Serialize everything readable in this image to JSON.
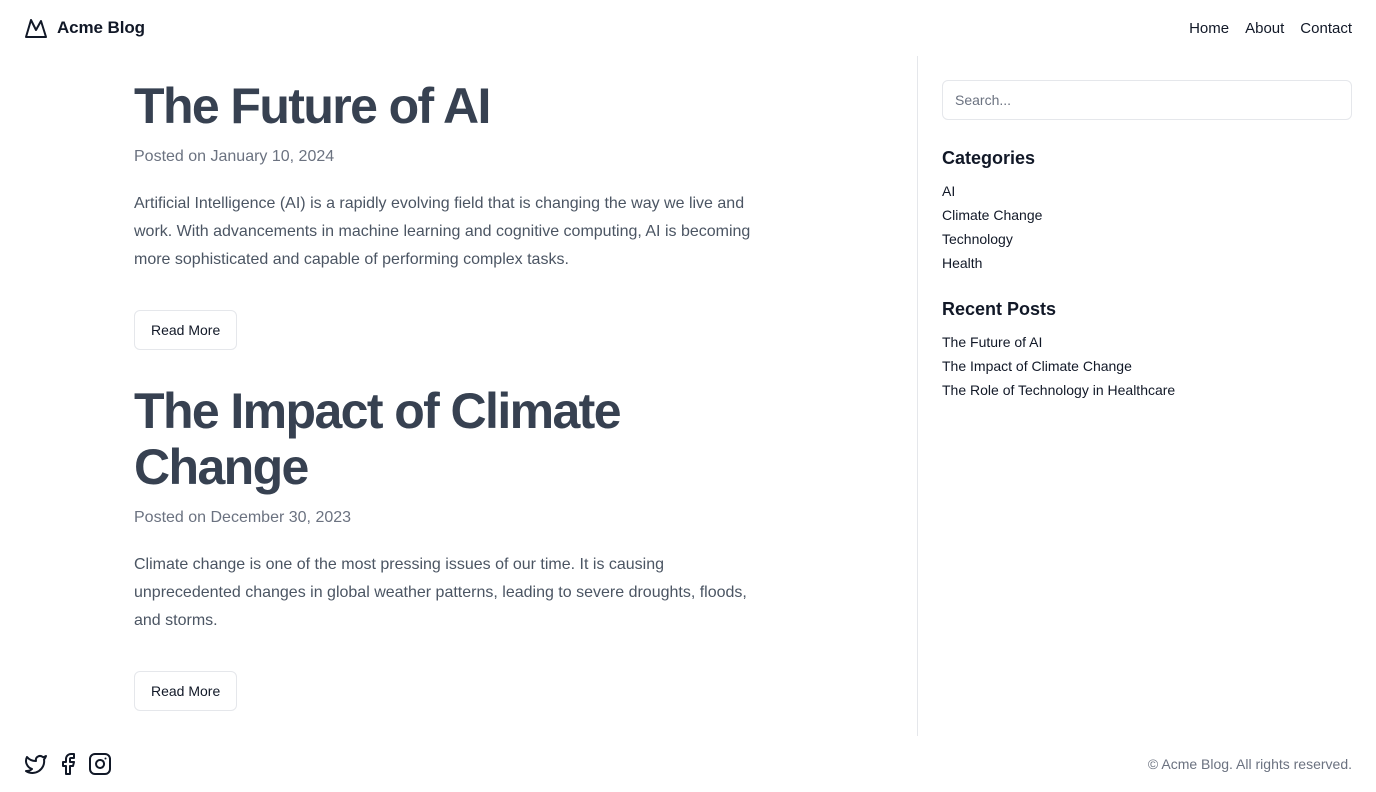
{
  "brand": {
    "name": "Acme Blog",
    "icon": "mountain-icon"
  },
  "nav": [
    {
      "label": "Home"
    },
    {
      "label": "About"
    },
    {
      "label": "Contact"
    }
  ],
  "posts": [
    {
      "title": "The Future of AI",
      "date": "Posted on January 10, 2024",
      "excerpt": "Artificial Intelligence (AI) is a rapidly evolving field that is changing the way we live and work. With advancements in machine learning and cognitive computing, AI is becoming more sophisticated and capable of performing complex tasks.",
      "button": "Read More"
    },
    {
      "title": "The Impact of Climate Change",
      "date": "Posted on December 30, 2023",
      "excerpt": "Climate change is one of the most pressing issues of our time. It is causing unprecedented changes in global weather patterns, leading to severe droughts, floods, and storms.",
      "button": "Read More"
    }
  ],
  "sidebar": {
    "search_placeholder": "Search...",
    "categories_heading": "Categories",
    "categories": [
      "AI",
      "Climate Change",
      "Technology",
      "Health"
    ],
    "recent_heading": "Recent Posts",
    "recent": [
      "The Future of AI",
      "The Impact of Climate Change",
      "The Role of Technology in Healthcare"
    ]
  },
  "footer": {
    "socials": [
      "twitter-icon",
      "facebook-icon",
      "instagram-icon"
    ],
    "copyright": "© Acme Blog. All rights reserved."
  },
  "colors": {
    "title": "#374151",
    "muted": "#6b7280",
    "border": "#e5e7eb",
    "text": "#111827"
  }
}
